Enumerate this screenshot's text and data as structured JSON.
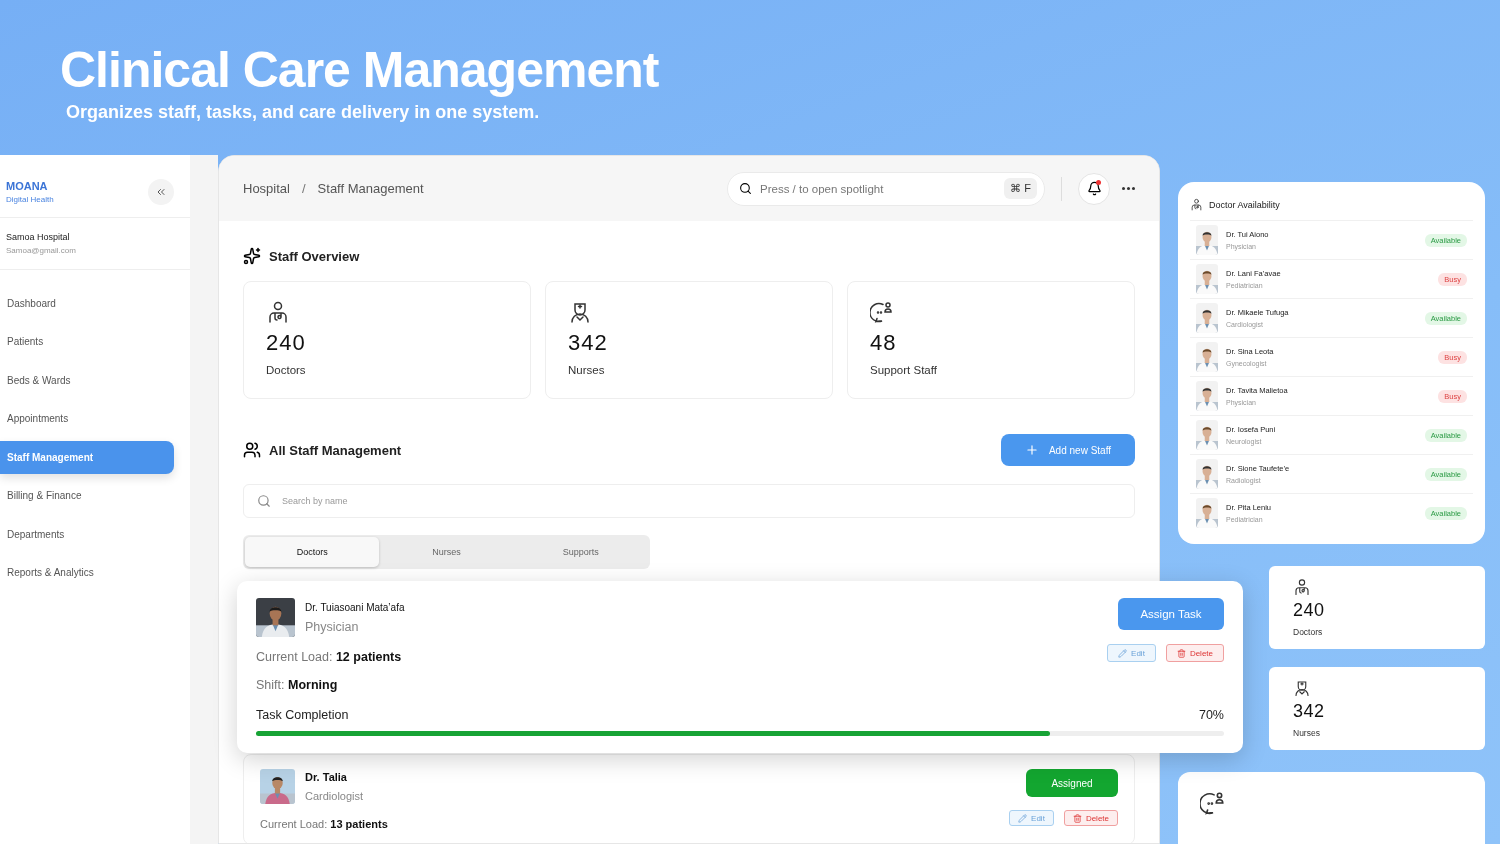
{
  "hero": {
    "title": "Clinical Care Management",
    "subtitle": "Organizes staff, tasks, and care delivery in one system."
  },
  "sidebar": {
    "brand": "MOANA",
    "brand_sub": "Digital Health",
    "hospital": "Samoa Hospital",
    "email": "Samoa@gmail.com",
    "items": [
      {
        "label": "Dashboard",
        "selected": false
      },
      {
        "label": "Patients",
        "selected": false
      },
      {
        "label": "Beds & Wards",
        "selected": false
      },
      {
        "label": "Appointments",
        "selected": false
      },
      {
        "label": "Staff Management",
        "selected": true
      },
      {
        "label": "Billing & Finance",
        "selected": false
      },
      {
        "label": "Departments",
        "selected": false
      },
      {
        "label": "Reports & Analytics",
        "selected": false
      }
    ]
  },
  "header": {
    "breadcrumb": [
      "Hospital",
      "Staff Management"
    ],
    "separator": "/",
    "search": {
      "placeholder": "Press / to open spotlight",
      "shortcut": "⌘ F"
    },
    "unread": true
  },
  "overview": {
    "title": "Staff Overview",
    "stats": [
      {
        "kind": "doctor",
        "value": "240",
        "label": "Doctors"
      },
      {
        "kind": "nurse",
        "value": "342",
        "label": "Nurses"
      },
      {
        "kind": "support",
        "value": "48",
        "label": "Support Staff"
      }
    ]
  },
  "staff": {
    "title": "All Staff Management",
    "add_button": "Add new Staff",
    "search": {
      "placeholder": "Search by name"
    },
    "tabs": [
      {
        "label": "Doctors",
        "selected": true
      },
      {
        "label": "Nurses",
        "selected": false
      },
      {
        "label": "Supports",
        "selected": false
      }
    ],
    "cards": [
      {
        "floating": true,
        "name": "Dr. Tuiasoani Mata’afa",
        "role": "Physician",
        "action": "Assign Task",
        "assigned": false,
        "edit": "Edit",
        "delete": "Delete",
        "load_label": "Current Load:",
        "load": "12 patients",
        "shift_label": "Shift:",
        "shift": "Morning",
        "completion_label": "Task Completion",
        "completion": "70%",
        "level": 0.82
      },
      {
        "floating": false,
        "name": "Dr. Talia",
        "role": "Cardiologist",
        "action": "Assigned",
        "assigned": true,
        "edit": "Edit",
        "delete": "Delete",
        "load_label": "Current Load:",
        "load": "13 patients"
      }
    ]
  },
  "availability": {
    "title": "Doctor Availability",
    "doctors": [
      {
        "name": "Dr. Tui Aiono",
        "role": "Physician",
        "status": "Available",
        "kind": "available"
      },
      {
        "name": "Dr. Lani Fa’avae",
        "role": "Pediatrician",
        "status": "Busy",
        "kind": "busy"
      },
      {
        "name": "Dr. Mikaele Tufuga",
        "role": "Cardiologist",
        "status": "Available",
        "kind": "available"
      },
      {
        "name": "Dr. Sina Leota",
        "role": "Gynecologist",
        "status": "Busy",
        "kind": "busy"
      },
      {
        "name": "Dr. Tavita Malietoa",
        "role": "Physician",
        "status": "Busy",
        "kind": "busy"
      },
      {
        "name": "Dr.  Iosefa Puni",
        "role": "Neurologist",
        "status": "Available",
        "kind": "available"
      },
      {
        "name": "Dr. Sione Taufete’e",
        "role": "Radiologist",
        "status": "Available",
        "kind": "available"
      },
      {
        "name": "Dr. Pita Leniu",
        "role": "Pediatrician",
        "status": "Available",
        "kind": "available"
      }
    ]
  },
  "side_stats": [
    {
      "kind": "doctor",
      "value": "240",
      "label": "Doctors"
    },
    {
      "kind": "nurse",
      "value": "342",
      "label": "Nurses"
    },
    {
      "kind": "support"
    }
  ]
}
